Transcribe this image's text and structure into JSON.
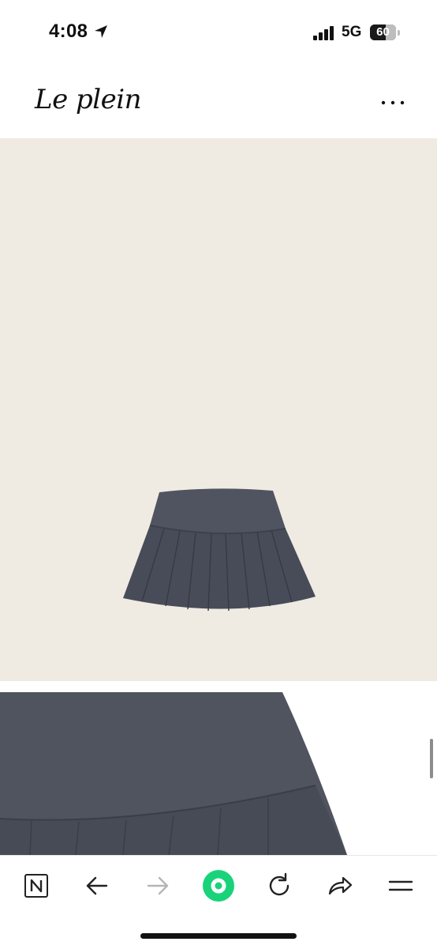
{
  "status_bar": {
    "time": "4:08",
    "network": "5G",
    "battery_level": "60",
    "battery_fraction": 0.6
  },
  "header": {
    "brand": "Le plein",
    "menu_icon": "more-horizontal-icon"
  },
  "gallery": {
    "images": [
      {
        "name": "product-image-skirt",
        "background": "#efebe3",
        "subject_color": "#4a4f5a"
      },
      {
        "name": "product-image-detail",
        "background": "#ffffff",
        "subject_color": "#4d525c"
      }
    ]
  },
  "toolbar": {
    "items": [
      {
        "icon": "naver-n-icon"
      },
      {
        "icon": "back-arrow-icon"
      },
      {
        "icon": "forward-arrow-icon",
        "disabled": true
      },
      {
        "icon": "green-home-icon",
        "color": "#19d37a"
      },
      {
        "icon": "refresh-icon"
      },
      {
        "icon": "share-icon"
      },
      {
        "icon": "menu-icon"
      }
    ]
  }
}
